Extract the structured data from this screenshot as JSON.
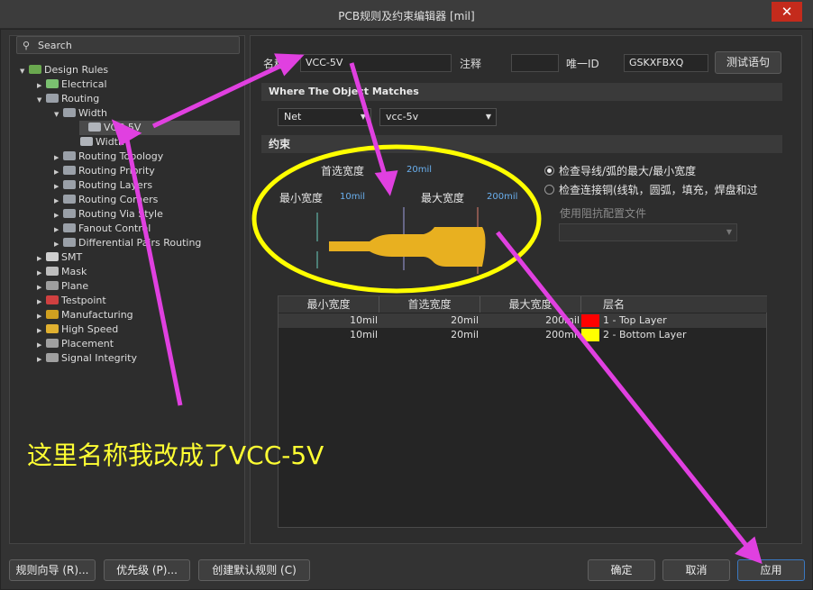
{
  "window": {
    "title": "PCB规则及约束编辑器 [mil]",
    "close_glyph": "✕"
  },
  "search": {
    "label": "Search"
  },
  "tree": [
    {
      "label": "Design Rules",
      "caret": "▼",
      "icon": "rules-icon"
    },
    {
      "label": "Electrical",
      "caret": "▶",
      "icon": "electrical-icon"
    },
    {
      "label": "Routing",
      "caret": "▼",
      "icon": "routing-icon"
    },
    {
      "label": "Width",
      "caret": "▼",
      "icon": "width-icon"
    },
    {
      "label": "VCC-5V",
      "caret": "",
      "icon": "width-rule-icon",
      "selected": true
    },
    {
      "label": "Width",
      "caret": "",
      "icon": "width-rule-icon"
    },
    {
      "label": "Routing Topology",
      "caret": "▶",
      "icon": "routing-icon"
    },
    {
      "label": "Routing Priority",
      "caret": "▶",
      "icon": "routing-icon"
    },
    {
      "label": "Routing Layers",
      "caret": "▶",
      "icon": "routing-icon"
    },
    {
      "label": "Routing Corners",
      "caret": "▶",
      "icon": "routing-icon"
    },
    {
      "label": "Routing Via Style",
      "caret": "▶",
      "icon": "routing-icon"
    },
    {
      "label": "Fanout Control",
      "caret": "▶",
      "icon": "routing-icon"
    },
    {
      "label": "Differential Pairs Routing",
      "caret": "▶",
      "icon": "routing-icon"
    },
    {
      "label": "SMT",
      "caret": "▶",
      "icon": "smt-icon"
    },
    {
      "label": "Mask",
      "caret": "▶",
      "icon": "mask-icon"
    },
    {
      "label": "Plane",
      "caret": "▶",
      "icon": "plane-icon"
    },
    {
      "label": "Testpoint",
      "caret": "▶",
      "icon": "testpoint-icon"
    },
    {
      "label": "Manufacturing",
      "caret": "▶",
      "icon": "manufacturing-icon"
    },
    {
      "label": "High Speed",
      "caret": "▶",
      "icon": "high-speed-icon"
    },
    {
      "label": "Placement",
      "caret": "▶",
      "icon": "placement-icon"
    },
    {
      "label": "Signal Integrity",
      "caret": "▶",
      "icon": "signal-integrity-icon"
    }
  ],
  "form": {
    "name_label": "名称",
    "name_value": "VCC-5V",
    "comment_label": "注释",
    "comment_value": "",
    "uid_label": "唯一ID",
    "uid_value": "GSKXFBXQ",
    "test_button": "测试语句"
  },
  "where": {
    "header": "Where The Object Matches",
    "type_value": "Net",
    "net_value": "vcc-5v"
  },
  "constraints": {
    "header": "约束",
    "preferred_label": "首选宽度",
    "preferred_value": "20mil",
    "min_label": "最小宽度",
    "min_value": "10mil",
    "max_label": "最大宽度",
    "max_value": "200mil",
    "radio1": "检查导线/弧的最大/最小宽度",
    "radio2": "检查连接铜(线轨，圆弧，填充，焊盘和过",
    "impedance_label": "使用阻抗配置文件",
    "impedance_value": ""
  },
  "table": {
    "headers": [
      "最小宽度",
      "首选宽度",
      "最大宽度",
      "层名"
    ],
    "rows": [
      {
        "min": "10mil",
        "pref": "20mil",
        "max": "200mil",
        "layer": "1 - Top Layer",
        "color": "#ff0000"
      },
      {
        "min": "10mil",
        "pref": "20mil",
        "max": "200mil",
        "layer": "2 - Bottom Layer",
        "color": "#ffff00"
      }
    ]
  },
  "buttons": {
    "wizard": "规则向导 (R)...",
    "priority": "优先级 (P)...",
    "create_default": "创建默认规则 (C)",
    "ok": "确定",
    "cancel": "取消",
    "apply": "应用"
  },
  "annotation": {
    "text": "这里名称我改成了VCC-5V",
    "color": "#ffff33",
    "arrow_color": "#e040e0",
    "ellipse_color": "#ffff00"
  },
  "colors": {
    "track": "#e8b020"
  }
}
